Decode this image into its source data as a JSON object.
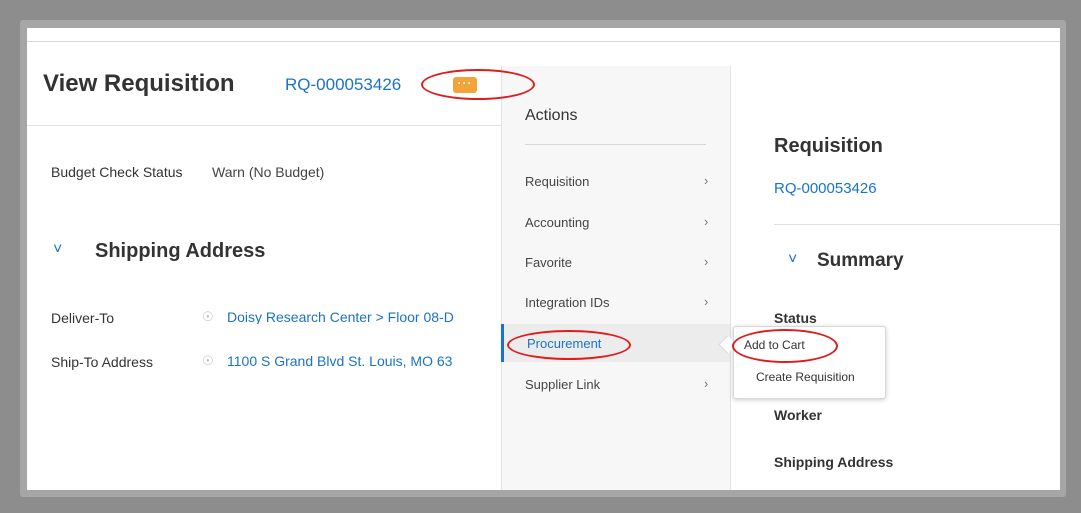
{
  "header": {
    "title": "View Requisition",
    "requisition_id": "RQ-000053426",
    "related_actions_glyph": "···"
  },
  "fields": {
    "budget_check_status_label": "Budget Check Status",
    "budget_check_status_value": "Warn (No Budget)"
  },
  "shipping": {
    "section_title": "Shipping Address",
    "deliver_to_label": "Deliver-To",
    "deliver_to_value": "Doisy Research Center > Floor 08-D",
    "ship_to_label": "Ship-To Address",
    "ship_to_value": "1100 S Grand Blvd St. Louis, MO 63"
  },
  "actions_menu": {
    "heading": "Actions",
    "items": [
      {
        "label": "Requisition"
      },
      {
        "label": "Accounting"
      },
      {
        "label": "Favorite"
      },
      {
        "label": "Integration IDs"
      },
      {
        "label": "Procurement"
      },
      {
        "label": "Supplier Link"
      }
    ]
  },
  "submenu": {
    "items": [
      {
        "label": "Add to Cart"
      },
      {
        "label": "Create Requisition"
      }
    ]
  },
  "right_panel": {
    "title": "Requisition",
    "requisition_id": "RQ-000053426",
    "summary_title": "Summary",
    "fields": [
      "Status",
      "Worker",
      "Shipping Address"
    ]
  },
  "icons": {
    "chevron_right": "›",
    "chevron_down": "˅",
    "location_pin": "☉"
  },
  "colors": {
    "link_blue": "#1a73c8",
    "related_actions_orange": "#f2a43a",
    "annotation_red": "#e01b1b"
  }
}
